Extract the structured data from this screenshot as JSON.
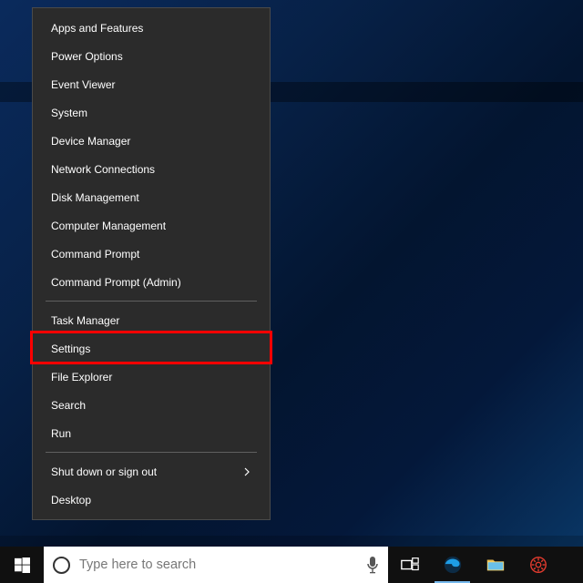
{
  "menu": {
    "groups": [
      [
        {
          "label": "Apps and Features",
          "hasSub": false
        },
        {
          "label": "Power Options",
          "hasSub": false
        },
        {
          "label": "Event Viewer",
          "hasSub": false
        },
        {
          "label": "System",
          "hasSub": false
        },
        {
          "label": "Device Manager",
          "hasSub": false
        },
        {
          "label": "Network Connections",
          "hasSub": false
        },
        {
          "label": "Disk Management",
          "hasSub": false
        },
        {
          "label": "Computer Management",
          "hasSub": false
        },
        {
          "label": "Command Prompt",
          "hasSub": false
        },
        {
          "label": "Command Prompt (Admin)",
          "hasSub": false
        }
      ],
      [
        {
          "label": "Task Manager",
          "hasSub": false
        },
        {
          "label": "Settings",
          "hasSub": false
        },
        {
          "label": "File Explorer",
          "hasSub": false
        },
        {
          "label": "Search",
          "hasSub": false
        },
        {
          "label": "Run",
          "hasSub": false
        }
      ],
      [
        {
          "label": "Shut down or sign out",
          "hasSub": true
        },
        {
          "label": "Desktop",
          "hasSub": false
        }
      ]
    ],
    "highlighted": "Settings"
  },
  "taskbar": {
    "search_placeholder": "Type here to search"
  }
}
